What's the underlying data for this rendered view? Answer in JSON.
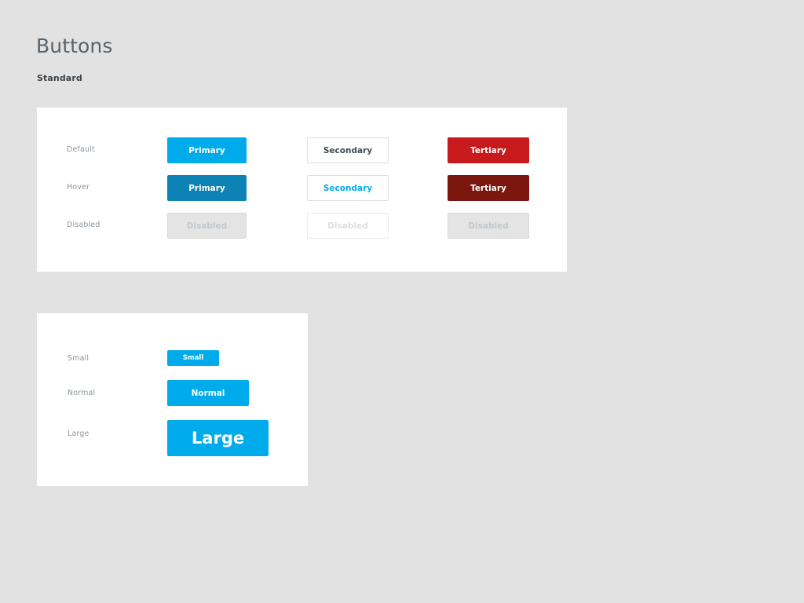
{
  "page": {
    "title": "Buttons",
    "background_color": "#e2e2e2",
    "sections": {
      "standard_label": "Standard"
    }
  },
  "colors": {
    "primary": "#00abeb",
    "primary_hover": "#0d82b4",
    "secondary_bg": "#ffffff",
    "secondary_text": "#444c52",
    "secondary_hover_text": "#00abeb",
    "secondary_border": "#dedede",
    "tertiary": "#c8191c",
    "tertiary_hover": "#7c1710",
    "disabled_bg": "#e4e4e4",
    "disabled_text": "#c2c8cc",
    "card_bg": "#ffffff",
    "title_text": "#59636b",
    "row_label_text": "#8d969e"
  },
  "standard_card": {
    "rows": [
      {
        "label": "Default",
        "buttons": [
          {
            "label": "Primary",
            "variant": "primary"
          },
          {
            "label": "Secondary",
            "variant": "secondary"
          },
          {
            "label": "Tertiary",
            "variant": "tertiary"
          }
        ]
      },
      {
        "label": "Hover",
        "buttons": [
          {
            "label": "Primary",
            "variant": "primary-hover"
          },
          {
            "label": "Secondary",
            "variant": "secondary-hover"
          },
          {
            "label": "Tertiary",
            "variant": "tertiary-hover"
          }
        ]
      },
      {
        "label": "Disabled",
        "buttons": [
          {
            "label": "Disabled",
            "variant": "disabled-filled"
          },
          {
            "label": "Disabled",
            "variant": "disabled-outline"
          },
          {
            "label": "Disabled",
            "variant": "disabled-filled"
          }
        ]
      }
    ]
  },
  "sizes_card": {
    "rows": [
      {
        "label": "Small",
        "button": {
          "label": "Small",
          "variant": "primary",
          "size": "small"
        }
      },
      {
        "label": "Normal",
        "button": {
          "label": "Normal",
          "variant": "primary",
          "size": "normal"
        }
      },
      {
        "label": "Large",
        "button": {
          "label": "Large",
          "variant": "primary",
          "size": "large"
        }
      }
    ]
  }
}
